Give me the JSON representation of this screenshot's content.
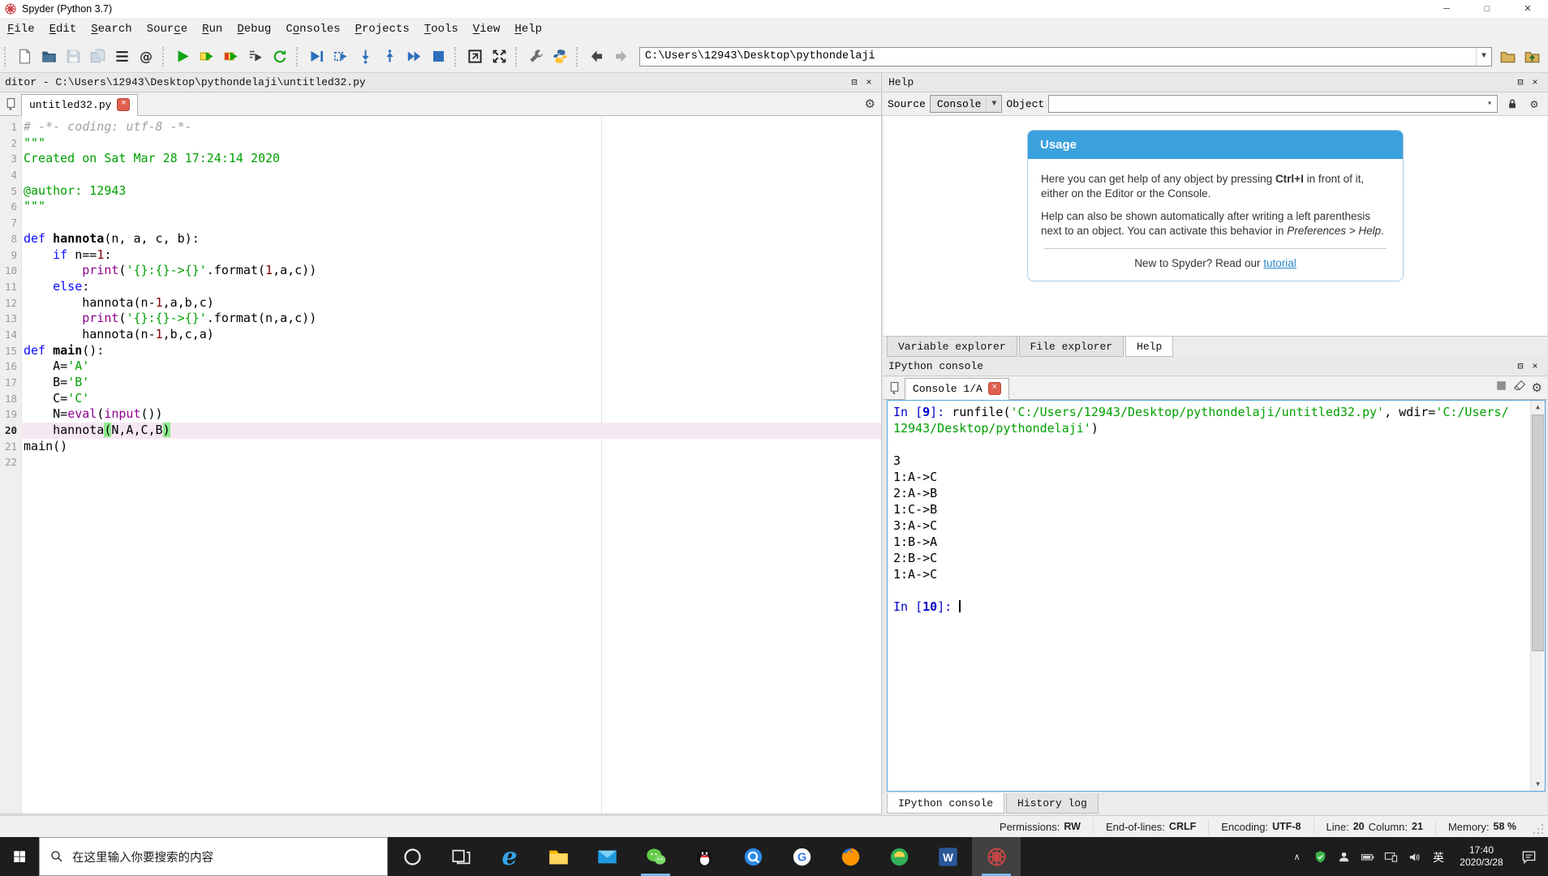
{
  "window": {
    "title": "Spyder (Python 3.7)"
  },
  "colors": {
    "accent_blue": "#3ba1dc",
    "console_focus_border": "#58a6dc",
    "current_line_bg": "#f6e8f2",
    "paren_match_bg": "#8ce98c",
    "keyword": "#0b0bff",
    "string": "#00a000",
    "builtin": "#900090",
    "comment": "#9f9f9f",
    "taskbar_bg": "#1d1d1d"
  },
  "menu": {
    "items": [
      {
        "id": "file",
        "pre": "",
        "key": "F",
        "post": "ile"
      },
      {
        "id": "edit",
        "pre": "",
        "key": "E",
        "post": "dit"
      },
      {
        "id": "search",
        "pre": "",
        "key": "S",
        "post": "earch"
      },
      {
        "id": "source",
        "pre": "Sour",
        "key": "c",
        "post": "e"
      },
      {
        "id": "run",
        "pre": "",
        "key": "R",
        "post": "un"
      },
      {
        "id": "debug",
        "pre": "",
        "key": "D",
        "post": "ebug"
      },
      {
        "id": "consoles",
        "pre": "C",
        "key": "o",
        "post": "nsoles"
      },
      {
        "id": "projects",
        "pre": "",
        "key": "P",
        "post": "rojects"
      },
      {
        "id": "tools",
        "pre": "",
        "key": "T",
        "post": "ools"
      },
      {
        "id": "view",
        "pre": "",
        "key": "V",
        "post": "iew"
      },
      {
        "id": "help",
        "pre": "",
        "key": "H",
        "post": "elp"
      }
    ]
  },
  "toolbar": {
    "groups": [
      [
        "new-file",
        "open-file",
        "save-file",
        "save-all",
        "file-switcher",
        "working-directory"
      ],
      [
        "run-file",
        "run-cell",
        "run-cell-advance",
        "run-selection",
        "rerun-cell"
      ],
      [
        "debug-file",
        "debug-cell",
        "step-into",
        "step-return",
        "debug-continue",
        "debug-stop"
      ],
      [
        "maximize-pane",
        "fullscreen"
      ],
      [
        "preferences",
        "python-path"
      ],
      [
        "nav-back",
        "nav-forward"
      ]
    ],
    "trailing": [
      "browse-directory",
      "parent-directory"
    ],
    "path_value": "C:\\Users\\12943\\Desktop\\pythondelaji"
  },
  "editor": {
    "pane_title": "ditor - C:\\Users\\12943\\Desktop\\pythondelaji\\untitled32.py",
    "tab_label": "untitled32.py",
    "current_line": 20,
    "lines": [
      {
        "n": 1,
        "t": [
          [
            "# -*- coding: utf-8 -*-",
            "com"
          ]
        ]
      },
      {
        "n": 2,
        "t": [
          [
            "\"\"\"",
            "str"
          ]
        ]
      },
      {
        "n": 3,
        "t": [
          [
            "Created on Sat Mar 28 17:24:14 2020",
            "str"
          ]
        ]
      },
      {
        "n": 4,
        "t": []
      },
      {
        "n": 5,
        "t": [
          [
            "@author: 12943",
            "str"
          ]
        ]
      },
      {
        "n": 6,
        "t": [
          [
            "\"\"\"",
            "str"
          ]
        ]
      },
      {
        "n": 7,
        "t": []
      },
      {
        "n": 8,
        "t": [
          [
            "def",
            "kw"
          ],
          [
            " ",
            "p"
          ],
          [
            "hannota",
            "fn"
          ],
          [
            "(n, a, c, b):",
            "p"
          ]
        ]
      },
      {
        "n": 9,
        "t": [
          [
            "    ",
            "p"
          ],
          [
            "if",
            "kw"
          ],
          [
            " n==",
            "p"
          ],
          [
            "1",
            "num"
          ],
          [
            ":",
            "p"
          ]
        ]
      },
      {
        "n": 10,
        "t": [
          [
            "        ",
            "p"
          ],
          [
            "print",
            "bi"
          ],
          [
            "(",
            "p"
          ],
          [
            "'{}:{}->{}'",
            "str"
          ],
          [
            ".format(",
            "p"
          ],
          [
            "1",
            "num"
          ],
          [
            ",a,c))",
            "p"
          ]
        ]
      },
      {
        "n": 11,
        "t": [
          [
            "    ",
            "p"
          ],
          [
            "else",
            "kw"
          ],
          [
            ":",
            "p"
          ]
        ]
      },
      {
        "n": 12,
        "t": [
          [
            "        hannota(n-",
            "p"
          ],
          [
            "1",
            "num"
          ],
          [
            ",a,b,c)",
            "p"
          ]
        ]
      },
      {
        "n": 13,
        "t": [
          [
            "        ",
            "p"
          ],
          [
            "print",
            "bi"
          ],
          [
            "(",
            "p"
          ],
          [
            "'{}:{}->{}'",
            "str"
          ],
          [
            ".format(n,a,c))",
            "p"
          ]
        ]
      },
      {
        "n": 14,
        "t": [
          [
            "        hannota(n-",
            "p"
          ],
          [
            "1",
            "num"
          ],
          [
            ",b,c,a)",
            "p"
          ]
        ]
      },
      {
        "n": 15,
        "t": [
          [
            "def",
            "kw"
          ],
          [
            " ",
            "p"
          ],
          [
            "main",
            "fn"
          ],
          [
            "():",
            "p"
          ]
        ]
      },
      {
        "n": 16,
        "t": [
          [
            "    A=",
            "p"
          ],
          [
            "'A'",
            "str"
          ]
        ]
      },
      {
        "n": 17,
        "t": [
          [
            "    B=",
            "p"
          ],
          [
            "'B'",
            "str"
          ]
        ]
      },
      {
        "n": 18,
        "t": [
          [
            "    C=",
            "p"
          ],
          [
            "'C'",
            "str"
          ]
        ]
      },
      {
        "n": 19,
        "t": [
          [
            "    N=",
            "p"
          ],
          [
            "eval",
            "bi"
          ],
          [
            "(",
            "p"
          ],
          [
            "input",
            "bi"
          ],
          [
            "())",
            "p"
          ]
        ]
      },
      {
        "n": 20,
        "t": [
          [
            "    hannota",
            "p"
          ],
          [
            "(",
            "match"
          ],
          [
            "N,A,C,B",
            "p"
          ],
          [
            ")",
            "match"
          ]
        ]
      },
      {
        "n": 21,
        "t": [
          [
            "main()",
            "p"
          ]
        ]
      },
      {
        "n": 22,
        "t": []
      }
    ]
  },
  "help": {
    "pane_title": "Help",
    "source_label": "Source",
    "source_value": "Console",
    "object_label": "Object",
    "object_value": "",
    "usage": {
      "title": "Usage",
      "p1_pre": "Here you can get help of any object by pressing ",
      "p1_bold": "Ctrl+I",
      "p1_post": " in front of it, either on the Editor or the Console.",
      "p2_pre": "Help can also be shown automatically after writing a left parenthesis next to an object. You can activate this behavior in ",
      "p2_italic": "Preferences > Help",
      "p2_post": ".",
      "footer_pre": "New to Spyder? Read our ",
      "footer_link": "tutorial"
    },
    "tabs": [
      {
        "id": "variable-explorer",
        "label": "Variable explorer",
        "active": false
      },
      {
        "id": "file-explorer",
        "label": "File explorer",
        "active": false
      },
      {
        "id": "help",
        "label": "Help",
        "active": true
      }
    ]
  },
  "console": {
    "pane_title": "IPython console",
    "tab_label": "Console 1/A",
    "lines": [
      {
        "t": [
          [
            "In [",
            "prompt"
          ],
          [
            "9",
            "promptb"
          ],
          [
            "]: ",
            "prompt"
          ],
          [
            "runfile(",
            "p"
          ],
          [
            "'C:/Users/12943/Desktop/pythondelaji/untitled32.py'",
            "str"
          ],
          [
            ", wdir=",
            "p"
          ],
          [
            "'C:/Users/",
            "str"
          ]
        ]
      },
      {
        "t": [
          [
            "12943/Desktop/pythondelaji'",
            "str"
          ],
          [
            ")",
            "p"
          ]
        ]
      },
      {
        "t": []
      },
      {
        "t": [
          [
            "3",
            "p"
          ]
        ]
      },
      {
        "t": [
          [
            "1:A->C",
            "p"
          ]
        ]
      },
      {
        "t": [
          [
            "2:A->B",
            "p"
          ]
        ]
      },
      {
        "t": [
          [
            "1:C->B",
            "p"
          ]
        ]
      },
      {
        "t": [
          [
            "3:A->C",
            "p"
          ]
        ]
      },
      {
        "t": [
          [
            "1:B->A",
            "p"
          ]
        ]
      },
      {
        "t": [
          [
            "2:B->C",
            "p"
          ]
        ]
      },
      {
        "t": [
          [
            "1:A->C",
            "p"
          ]
        ]
      },
      {
        "t": []
      },
      {
        "t": [
          [
            "In [",
            "prompt"
          ],
          [
            "10",
            "promptb"
          ],
          [
            "]: ",
            "prompt"
          ]
        ],
        "cursor": true
      }
    ],
    "bottom_tabs": [
      {
        "id": "ipython-console",
        "label": "IPython console",
        "active": true
      },
      {
        "id": "history-log",
        "label": "History log",
        "active": false
      }
    ]
  },
  "statusbar": {
    "cells": [
      {
        "parts": [
          {
            "label": "Permissions:",
            "value": "RW"
          }
        ]
      },
      {
        "parts": [
          {
            "label": "End-of-lines:",
            "value": "CRLF"
          }
        ]
      },
      {
        "parts": [
          {
            "label": "Encoding:",
            "value": "UTF-8"
          }
        ]
      },
      {
        "parts": [
          {
            "label": "Line:",
            "value": "20"
          },
          {
            "label": "Column:",
            "value": "21"
          }
        ]
      },
      {
        "parts": [
          {
            "label": "Memory:",
            "value": "58 %"
          }
        ]
      }
    ]
  },
  "taskbar": {
    "search_placeholder": "在这里输入你要搜索的内容",
    "ime": "英",
    "time": "17:40",
    "date": "2020/3/28",
    "apps": [
      {
        "id": "cortana",
        "icon": "cortana"
      },
      {
        "id": "task-view",
        "icon": "task-view"
      },
      {
        "id": "edge",
        "icon": "edge"
      },
      {
        "id": "file-explorer",
        "icon": "file-explorer"
      },
      {
        "id": "mail",
        "icon": "mail"
      },
      {
        "id": "wechat",
        "icon": "wechat",
        "running": true
      },
      {
        "id": "qq",
        "icon": "qq"
      },
      {
        "id": "qq-browser",
        "icon": "qq-browser"
      },
      {
        "id": "g-browser",
        "icon": "g-browser"
      },
      {
        "id": "firefox",
        "icon": "firefox"
      },
      {
        "id": "green-app",
        "icon": "green-app"
      },
      {
        "id": "word",
        "icon": "word"
      },
      {
        "id": "spyder",
        "icon": "spyder",
        "running": true,
        "active": true
      }
    ],
    "tray": [
      {
        "id": "tray-expand",
        "icon": "chevron-up"
      },
      {
        "id": "tray-shield",
        "icon": "tray-shield"
      },
      {
        "id": "tray-person",
        "icon": "tray-person"
      },
      {
        "id": "tray-battery",
        "icon": "tray-battery"
      },
      {
        "id": "tray-display",
        "icon": "tray-display"
      },
      {
        "id": "tray-volume",
        "icon": "tray-volume"
      }
    ]
  }
}
